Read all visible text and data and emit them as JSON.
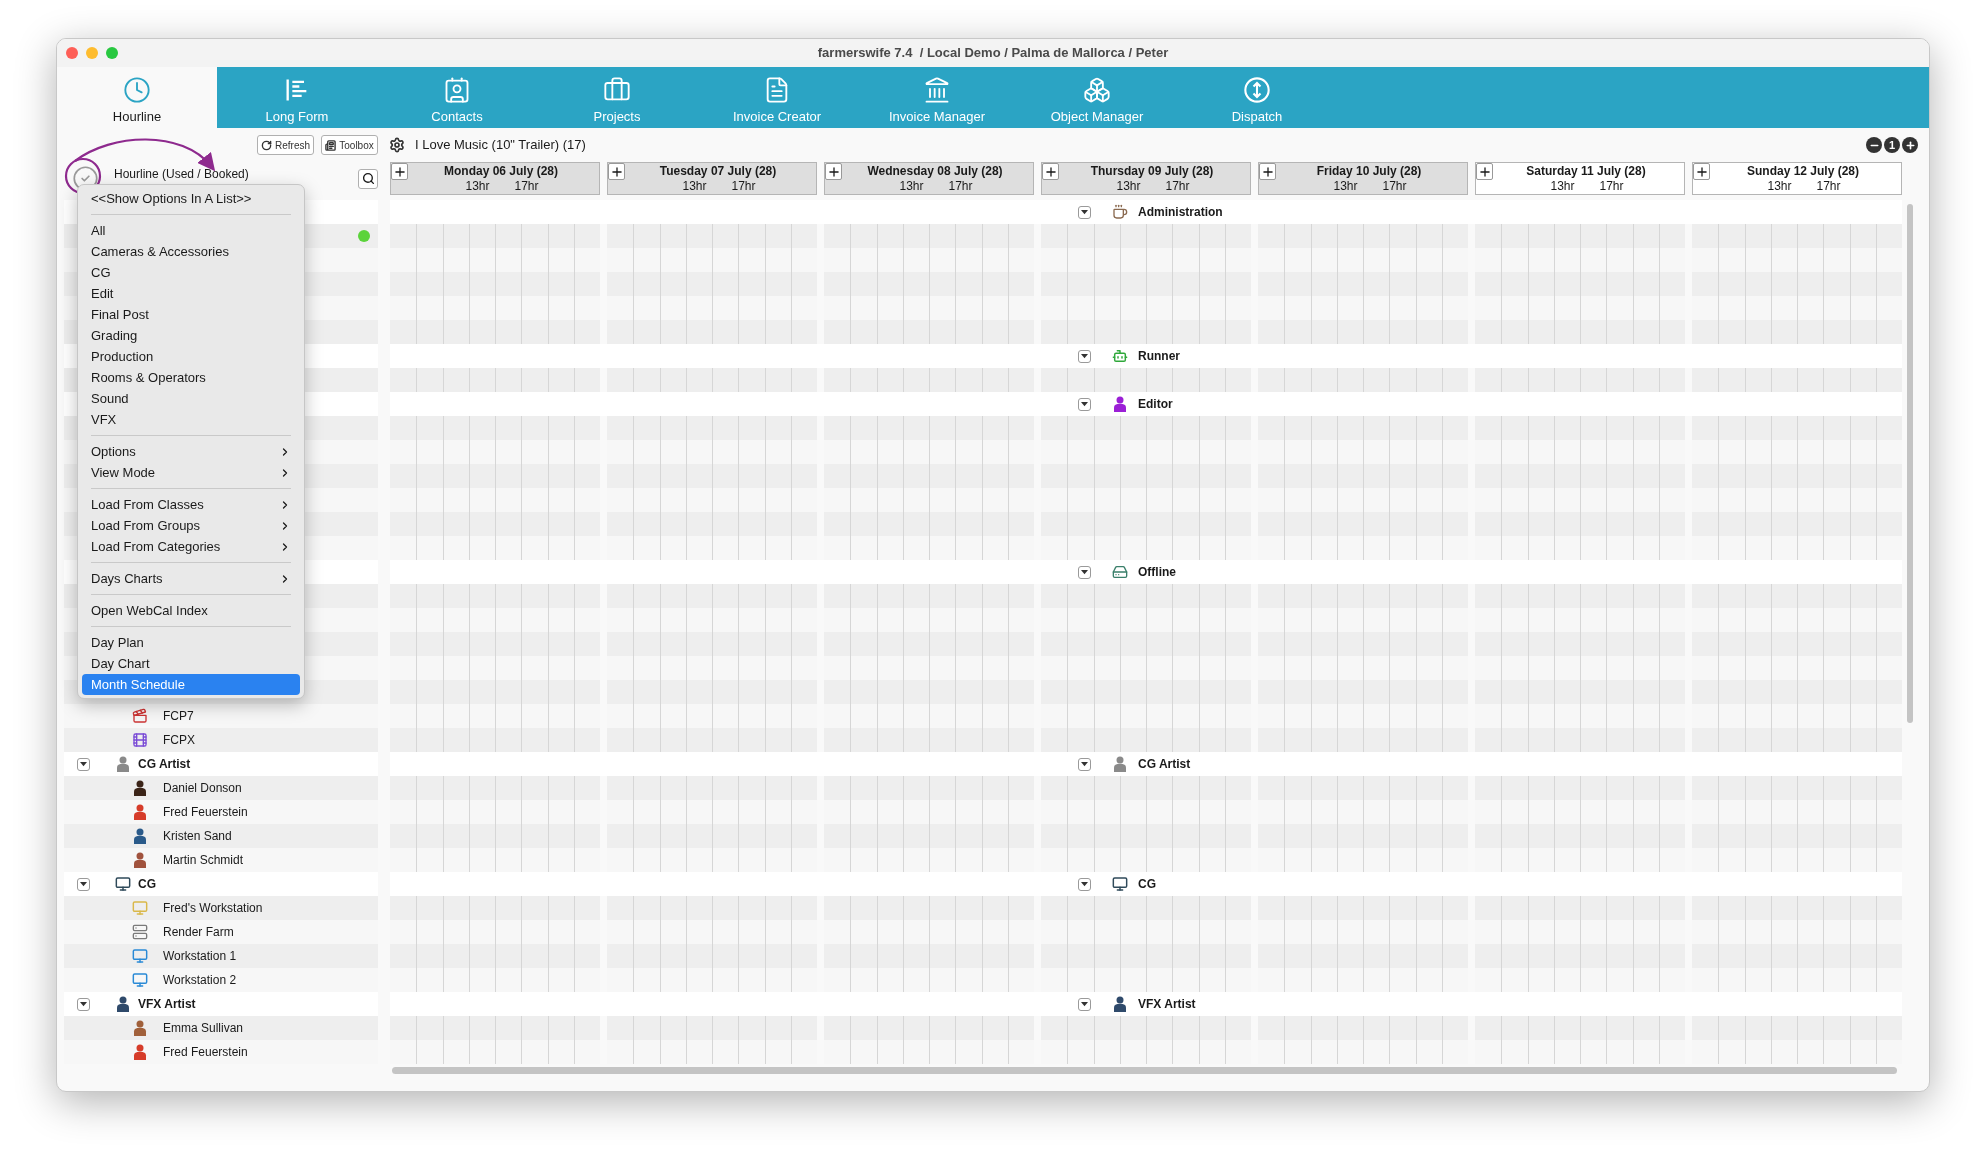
{
  "window": {
    "title": "farmerswife 7.4  / Local Demo / Palma de Mallorca / Peter"
  },
  "tabs": [
    {
      "label": "Hourline",
      "kind": "clock",
      "selected": true
    },
    {
      "label": "Long Form",
      "kind": "gantt",
      "selected": false
    },
    {
      "label": "Contacts",
      "kind": "contacts",
      "selected": false
    },
    {
      "label": "Projects",
      "kind": "briefcase",
      "selected": false
    },
    {
      "label": "Invoice Creator",
      "kind": "document",
      "selected": false
    },
    {
      "label": "Invoice Manager",
      "kind": "bank",
      "selected": false
    },
    {
      "label": "Object Manager",
      "kind": "boxes",
      "selected": false
    },
    {
      "label": "Dispatch",
      "kind": "dispatch",
      "selected": false
    }
  ],
  "toolbar": {
    "buttons": [
      {
        "label": "Refresh",
        "kind": "refresh"
      },
      {
        "label": "Toolbox",
        "kind": "toolbox"
      }
    ],
    "project": "I Love Music (10\" Trailer) (17)",
    "zoom_controls": [
      {
        "kind": "minus"
      },
      {
        "kind": "reset",
        "label": "1"
      },
      {
        "kind": "plus"
      }
    ]
  },
  "left_panel": {
    "title": "Hourline (Used / Booked)",
    "status_dot": {
      "color": "#5bd33a"
    },
    "rows": [
      {
        "label": "FCP7",
        "kind": "clapper"
      },
      {
        "label": "FCPX",
        "kind": "film"
      },
      {
        "label": "CG Artist",
        "kind": "person",
        "color": "#8a8a8a",
        "expanded": true,
        "children": [
          {
            "label": "Daniel Donson",
            "kind": "person",
            "color": "#3b2418"
          },
          {
            "label": "Fred Feuerstein",
            "kind": "person",
            "color": "#d63c2a"
          },
          {
            "label": "Kristen Sand",
            "kind": "person",
            "color": "#2a5a8a"
          },
          {
            "label": "Martin Schmidt",
            "kind": "person",
            "color": "#a0523d"
          }
        ]
      },
      {
        "label": "CG",
        "kind": "monitor",
        "color": "#2f4a5a",
        "expanded": true,
        "children": [
          {
            "label": "Fred's Workstation",
            "kind": "monitor",
            "color": "#d9b84a"
          },
          {
            "label": "Render Farm",
            "kind": "server"
          },
          {
            "label": "Workstation 1",
            "kind": "monitor",
            "color": "#2a8ad6"
          },
          {
            "label": "Workstation 2",
            "kind": "monitor",
            "color": "#2a8ad6"
          }
        ]
      },
      {
        "label": "VFX Artist",
        "kind": "person",
        "color": "#2f4a6b",
        "expanded": true,
        "children": [
          {
            "label": "Emma Sullivan",
            "kind": "person",
            "color": "#a0603a"
          },
          {
            "label": "Fred Feuerstein",
            "kind": "person",
            "color": "#d63c2a"
          }
        ]
      }
    ]
  },
  "days": [
    {
      "label": "Monday 06 July (28)",
      "hours": [
        "13hr",
        "17hr"
      ],
      "weekend": false
    },
    {
      "label": "Tuesday 07 July (28)",
      "hours": [
        "13hr",
        "17hr"
      ],
      "weekend": false
    },
    {
      "label": "Wednesday 08 July (28)",
      "hours": [
        "13hr",
        "17hr"
      ],
      "weekend": false
    },
    {
      "label": "Thursday 09 July (28)",
      "hours": [
        "13hr",
        "17hr"
      ],
      "weekend": false
    },
    {
      "label": "Friday 10 July (28)",
      "hours": [
        "13hr",
        "17hr"
      ],
      "weekend": false
    },
    {
      "label": "Saturday 11 July (28)",
      "hours": [
        "13hr",
        "17hr"
      ],
      "weekend": true
    },
    {
      "label": "Sunday 12 July (28)",
      "hours": [
        "13hr",
        "17hr"
      ],
      "weekend": true
    }
  ],
  "groups": [
    {
      "label": "Administration",
      "kind": "cup",
      "expanded": true
    },
    {
      "label": "Runner",
      "kind": "robot",
      "expanded": true
    },
    {
      "label": "Editor",
      "kind": "person",
      "color": "#9b1fd6",
      "expanded": true
    },
    {
      "label": "Offline",
      "kind": "drive",
      "expanded": true
    },
    {
      "label": "CG Artist",
      "kind": "person",
      "color": "#8a8a8a",
      "expanded": true
    },
    {
      "label": "CG",
      "kind": "monitor",
      "color": "#2f4a5a",
      "expanded": true
    },
    {
      "label": "VFX Artist",
      "kind": "person",
      "color": "#2f4a6b",
      "expanded": true
    }
  ],
  "menu": {
    "sections": [
      [
        {
          "label": "<<Show Options In A List>>",
          "submenu": false,
          "selected": false
        }
      ],
      [
        {
          "label": "All",
          "submenu": false,
          "selected": false
        },
        {
          "label": "Cameras & Accessories",
          "submenu": false,
          "selected": false
        },
        {
          "label": "CG",
          "submenu": false,
          "selected": false
        },
        {
          "label": "Edit",
          "submenu": false,
          "selected": false
        },
        {
          "label": "Final Post",
          "submenu": false,
          "selected": false
        },
        {
          "label": "Grading",
          "submenu": false,
          "selected": false
        },
        {
          "label": "Production",
          "submenu": false,
          "selected": false
        },
        {
          "label": "Rooms & Operators",
          "submenu": false,
          "selected": false
        },
        {
          "label": "Sound",
          "submenu": false,
          "selected": false
        },
        {
          "label": "VFX",
          "submenu": false,
          "selected": false
        }
      ],
      [
        {
          "label": "Options",
          "submenu": true,
          "selected": false
        },
        {
          "label": "View Mode",
          "submenu": true,
          "selected": false
        }
      ],
      [
        {
          "label": "Load From Classes",
          "submenu": true,
          "selected": false
        },
        {
          "label": "Load From Groups",
          "submenu": true,
          "selected": false
        },
        {
          "label": "Load From Categories",
          "submenu": true,
          "selected": false
        }
      ],
      [
        {
          "label": "Days Charts",
          "submenu": true,
          "selected": false
        }
      ],
      [
        {
          "label": "Open WebCal Index",
          "submenu": false,
          "selected": false
        }
      ],
      [
        {
          "label": "Day Plan",
          "submenu": false,
          "selected": false
        },
        {
          "label": "Day Chart",
          "submenu": false,
          "selected": false
        },
        {
          "label": "Month Schedule",
          "submenu": false,
          "selected": true
        }
      ]
    ]
  }
}
